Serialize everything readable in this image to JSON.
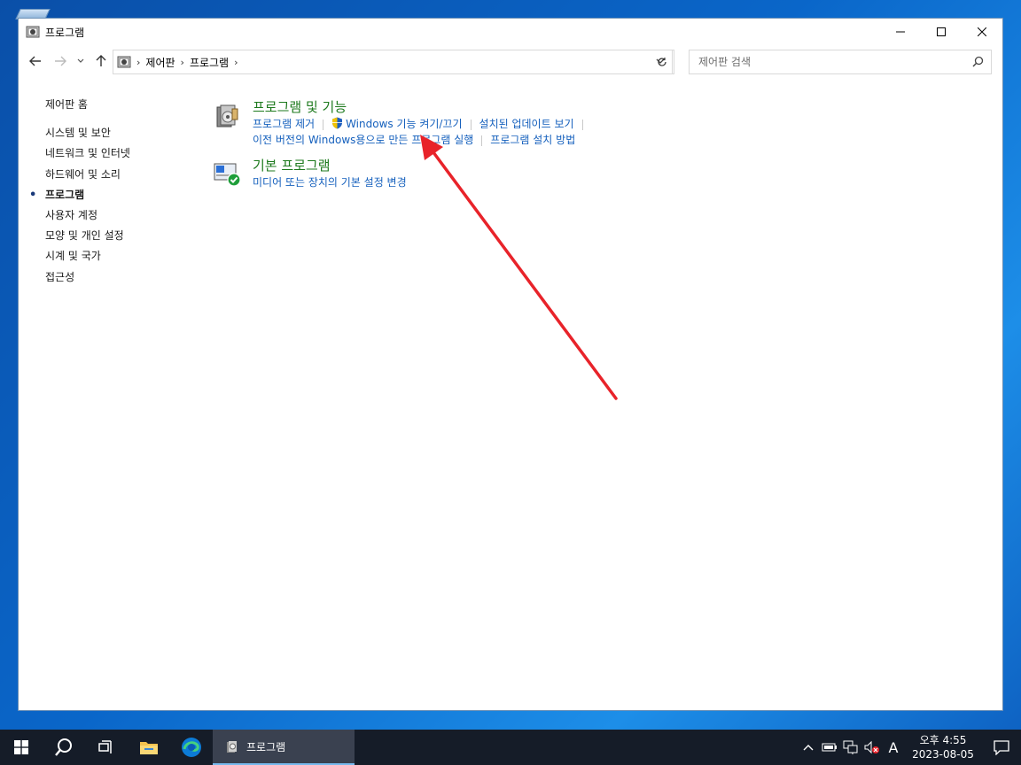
{
  "window": {
    "title": "프로그램",
    "minimize_icon": "minimize-icon",
    "maximize_icon": "maximize-icon",
    "close_icon": "close-icon"
  },
  "address_bar": {
    "breadcrumbs": [
      "제어판",
      "프로그램"
    ]
  },
  "search": {
    "placeholder": "제어판 검색"
  },
  "sidebar": {
    "home": "제어판 홈",
    "items": [
      {
        "label": "시스템 및 보안",
        "active": false
      },
      {
        "label": "네트워크 및 인터넷",
        "active": false
      },
      {
        "label": "하드웨어 및 소리",
        "active": false
      },
      {
        "label": "프로그램",
        "active": true
      },
      {
        "label": "사용자 계정",
        "active": false
      },
      {
        "label": "모양 및 개인 설정",
        "active": false
      },
      {
        "label": "시계 및 국가",
        "active": false
      },
      {
        "label": "접근성",
        "active": false
      }
    ]
  },
  "categories": [
    {
      "title": "프로그램 및 기능",
      "icon": "programs-features-icon",
      "row1": [
        "프로그램 제거",
        "Windows 기능 켜기/끄기",
        "설치된 업데이트 보기"
      ],
      "row2": [
        "이전 버전의 Windows용으로 만든 프로그램 실행",
        "프로그램 설치 방법"
      ]
    },
    {
      "title": "기본 프로그램",
      "icon": "default-programs-icon",
      "row1": [
        "미디어 또는 장치의 기본 설정 변경"
      ]
    }
  ],
  "taskbar": {
    "active_task": "프로그램",
    "ime": "A",
    "clock_time": "오후 4:55",
    "clock_date": "2023-08-05"
  },
  "colors": {
    "annotation_arrow": "#e8232a",
    "category_title": "#1e7a1e",
    "link": "#1560bd",
    "taskbar": "#151c28"
  }
}
